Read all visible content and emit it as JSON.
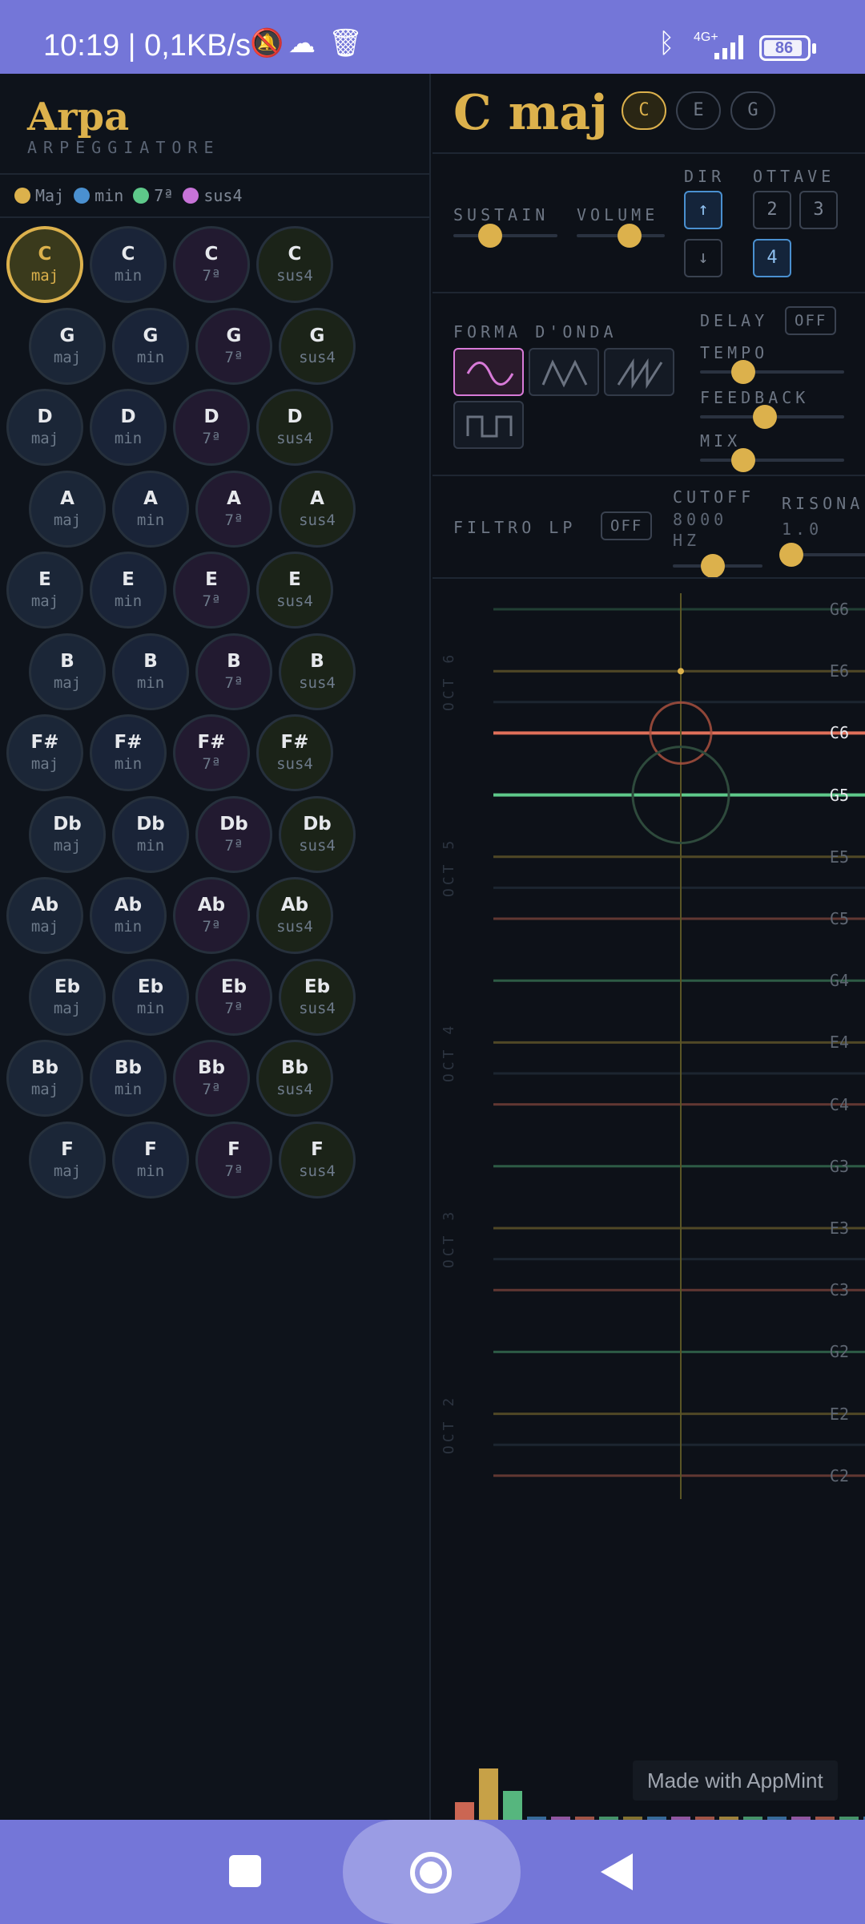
{
  "status": {
    "time": "10:19",
    "speed": "| 0,1KB/s",
    "network": "4G+",
    "battery": "86"
  },
  "app": {
    "title": "Arpa",
    "subtitle": "ARPEGGIATORE"
  },
  "legend": [
    {
      "label": "Maj",
      "color": "#dcb14c"
    },
    {
      "label": "min",
      "color": "#4a90d0"
    },
    {
      "label": "7ª",
      "color": "#5ec98a"
    },
    {
      "label": "sus4",
      "color": "#c773d8"
    }
  ],
  "chords": [
    {
      "root": "C",
      "qualities": [
        "maj",
        "min",
        "7ª",
        "sus4"
      ]
    },
    {
      "root": "G",
      "qualities": [
        "maj",
        "min",
        "7ª",
        "sus4"
      ]
    },
    {
      "root": "D",
      "qualities": [
        "maj",
        "min",
        "7ª",
        "sus4"
      ]
    },
    {
      "root": "A",
      "qualities": [
        "maj",
        "min",
        "7ª",
        "sus4"
      ]
    },
    {
      "root": "E",
      "qualities": [
        "maj",
        "min",
        "7ª",
        "sus4"
      ]
    },
    {
      "root": "B",
      "qualities": [
        "maj",
        "min",
        "7ª",
        "sus4"
      ]
    },
    {
      "root": "F#",
      "qualities": [
        "maj",
        "min",
        "7ª",
        "sus4"
      ]
    },
    {
      "root": "Db",
      "qualities": [
        "maj",
        "min",
        "7ª",
        "sus4"
      ]
    },
    {
      "root": "Ab",
      "qualities": [
        "maj",
        "min",
        "7ª",
        "sus4"
      ]
    },
    {
      "root": "Eb",
      "qualities": [
        "maj",
        "min",
        "7ª",
        "sus4"
      ]
    },
    {
      "root": "Bb",
      "qualities": [
        "maj",
        "min",
        "7ª",
        "sus4"
      ]
    },
    {
      "root": "F",
      "qualities": [
        "maj",
        "min",
        "7ª",
        "sus4"
      ]
    }
  ],
  "selected_chord": {
    "root": "C",
    "quality": "maj"
  },
  "current": {
    "name": "C maj",
    "notes": [
      "C",
      "E",
      "G"
    ],
    "active_note": "C"
  },
  "controls": {
    "sustain_label": "SUSTAIN",
    "sustain_value": 0.35,
    "volume_label": "VOLUME",
    "volume_value": 0.6,
    "dir_label": "DIR",
    "dir_up": "↑",
    "dir_down": "↓",
    "dir_selected": "up",
    "octave_label": "OTTAVE",
    "octaves": [
      "2",
      "3",
      "4"
    ],
    "octave_selected": "4",
    "waveform_label": "FORMA D'ONDA",
    "waveforms": [
      "sine",
      "triangle",
      "sawtooth",
      "square"
    ],
    "waveform_selected": "sine",
    "delay_label": "DELAY",
    "delay_state": "OFF",
    "tempo_label": "TEMPO",
    "tempo_value": 0.3,
    "feedback_label": "FEEDBACK",
    "feedback_value": 0.45,
    "mix_label": "MIX",
    "mix_value": 0.3,
    "filter_label": "FILTRO LP",
    "filter_state": "OFF",
    "cutoff_label": "CUTOFF",
    "cutoff_value_text": "8000",
    "cutoff_unit": "HZ",
    "cutoff_value": 0.45,
    "resonance_label": "RISONA",
    "resonance_value_text": "1.0",
    "resonance_value": 0.1
  },
  "harp": {
    "strings": [
      "G6",
      "E6",
      "C6",
      "G5",
      "E5",
      "C5",
      "G4",
      "E4",
      "C4",
      "G3",
      "E3",
      "C3",
      "G2",
      "E2",
      "C2"
    ],
    "octave_labels": [
      "OCT 6",
      "OCT 5",
      "OCT 4",
      "OCT 3",
      "OCT 2"
    ],
    "active_strings": [
      "C6",
      "G5"
    ],
    "colors": {
      "C": "#e0705a",
      "E": "#b59a3c",
      "G": "#5ec98a"
    }
  },
  "watermark": "Made with AppMint"
}
